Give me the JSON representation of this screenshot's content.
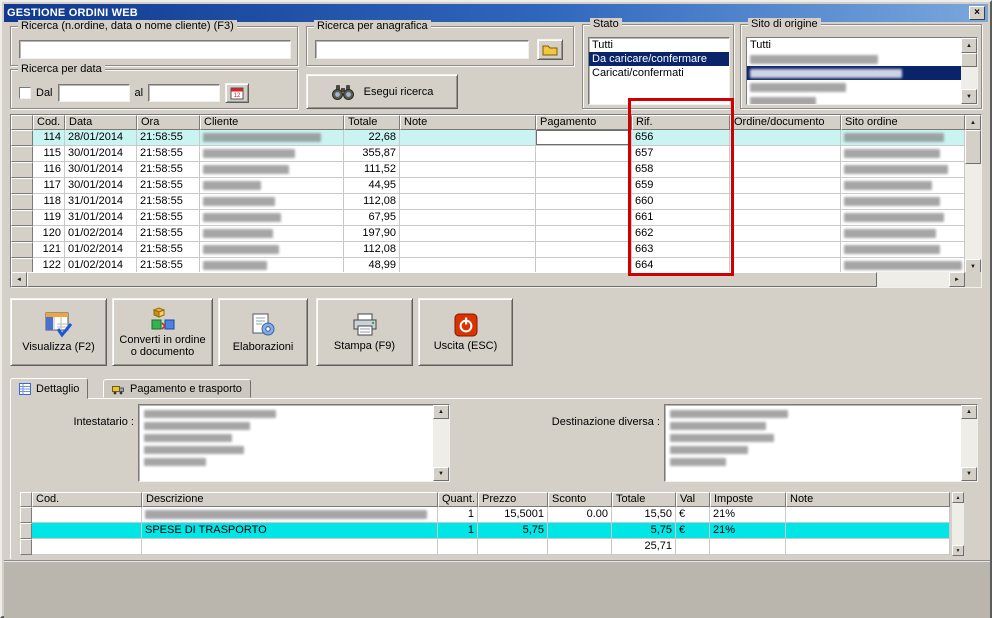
{
  "window": {
    "title": "GESTIONE ORDINI WEB",
    "close": "×"
  },
  "filters": {
    "search_order": {
      "label": "Ricerca (n.ordine, data o nome cliente) (F3)",
      "value": ""
    },
    "search_anagrafica": {
      "label": "Ricerca per anagrafica",
      "value": ""
    },
    "search_date": {
      "label": "Ricerca per data",
      "dal": "Dal",
      "al": "al",
      "dal_value": "",
      "al_value": ""
    },
    "execute_button": "Esegui ricerca",
    "stato": {
      "label": "Stato",
      "options": [
        "Tutti",
        "Da caricare/confermare",
        "Caricati/confermati"
      ],
      "selected": "Da caricare/confermare"
    },
    "sito": {
      "label": "Sito di origine",
      "visible_option": "Tutti"
    }
  },
  "orders": {
    "columns": {
      "cod": "Cod.",
      "data": "Data",
      "ora": "Ora",
      "cliente": "Cliente",
      "totale": "Totale",
      "note": "Note",
      "pagamento": "Pagamento",
      "rif": "Rif.",
      "ordine": "Ordine/documento",
      "sito": "Sito ordine"
    },
    "rows": [
      {
        "cod": "114",
        "data": "28/01/2014",
        "ora": "21:58:55",
        "totale": "22,68",
        "rif": "656"
      },
      {
        "cod": "115",
        "data": "30/01/2014",
        "ora": "21:58:55",
        "totale": "355,87",
        "rif": "657"
      },
      {
        "cod": "116",
        "data": "30/01/2014",
        "ora": "21:58:55",
        "totale": "111,52",
        "rif": "658"
      },
      {
        "cod": "117",
        "data": "30/01/2014",
        "ora": "21:58:55",
        "totale": "44,95",
        "rif": "659"
      },
      {
        "cod": "118",
        "data": "31/01/2014",
        "ora": "21:58:55",
        "totale": "112,08",
        "rif": "660"
      },
      {
        "cod": "119",
        "data": "31/01/2014",
        "ora": "21:58:55",
        "totale": "67,95",
        "rif": "661"
      },
      {
        "cod": "120",
        "data": "01/02/2014",
        "ora": "21:58:55",
        "totale": "197,90",
        "rif": "662"
      },
      {
        "cod": "121",
        "data": "01/02/2014",
        "ora": "21:58:55",
        "totale": "112,08",
        "rif": "663"
      },
      {
        "cod": "122",
        "data": "01/02/2014",
        "ora": "21:58:55",
        "totale": "48,99",
        "rif": "664"
      }
    ]
  },
  "toolbar": {
    "visualizza": "Visualizza (F2)",
    "converti": "Converti in ordine o documento",
    "elaborazioni": "Elaborazioni",
    "stampa": "Stampa (F9)",
    "uscita": "Uscita (ESC)"
  },
  "tabs": {
    "dettaglio": "Dettaglio",
    "pagamento": "Pagamento e trasporto"
  },
  "detail": {
    "intestatario_label": "Intestatario :",
    "destinazione_label": "Destinazione diversa :"
  },
  "detail_grid": {
    "columns": {
      "cod": "Cod.",
      "descrizione": "Descrizione",
      "quant": "Quant.",
      "prezzo": "Prezzo",
      "sconto": "Sconto",
      "totale": "Totale",
      "val": "Val",
      "imposte": "Imposte",
      "note": "Note"
    },
    "rows": [
      {
        "descrizione": "",
        "quant": "1",
        "prezzo": "15,5001",
        "sconto": "0.00",
        "totale": "15,50",
        "val": "€",
        "imposte": "21%"
      },
      {
        "descrizione": "SPESE DI TRASPORTO",
        "quant": "1",
        "prezzo": "5,75",
        "sconto": "",
        "totale": "5,75",
        "val": "€",
        "imposte": "21%"
      }
    ],
    "total": "25,71"
  },
  "colors": {
    "selected_row": "#c9f4f2",
    "highlight_row": "#00e5e5",
    "selection_navy": "#0a246a",
    "annotation_red": "#d10000"
  }
}
